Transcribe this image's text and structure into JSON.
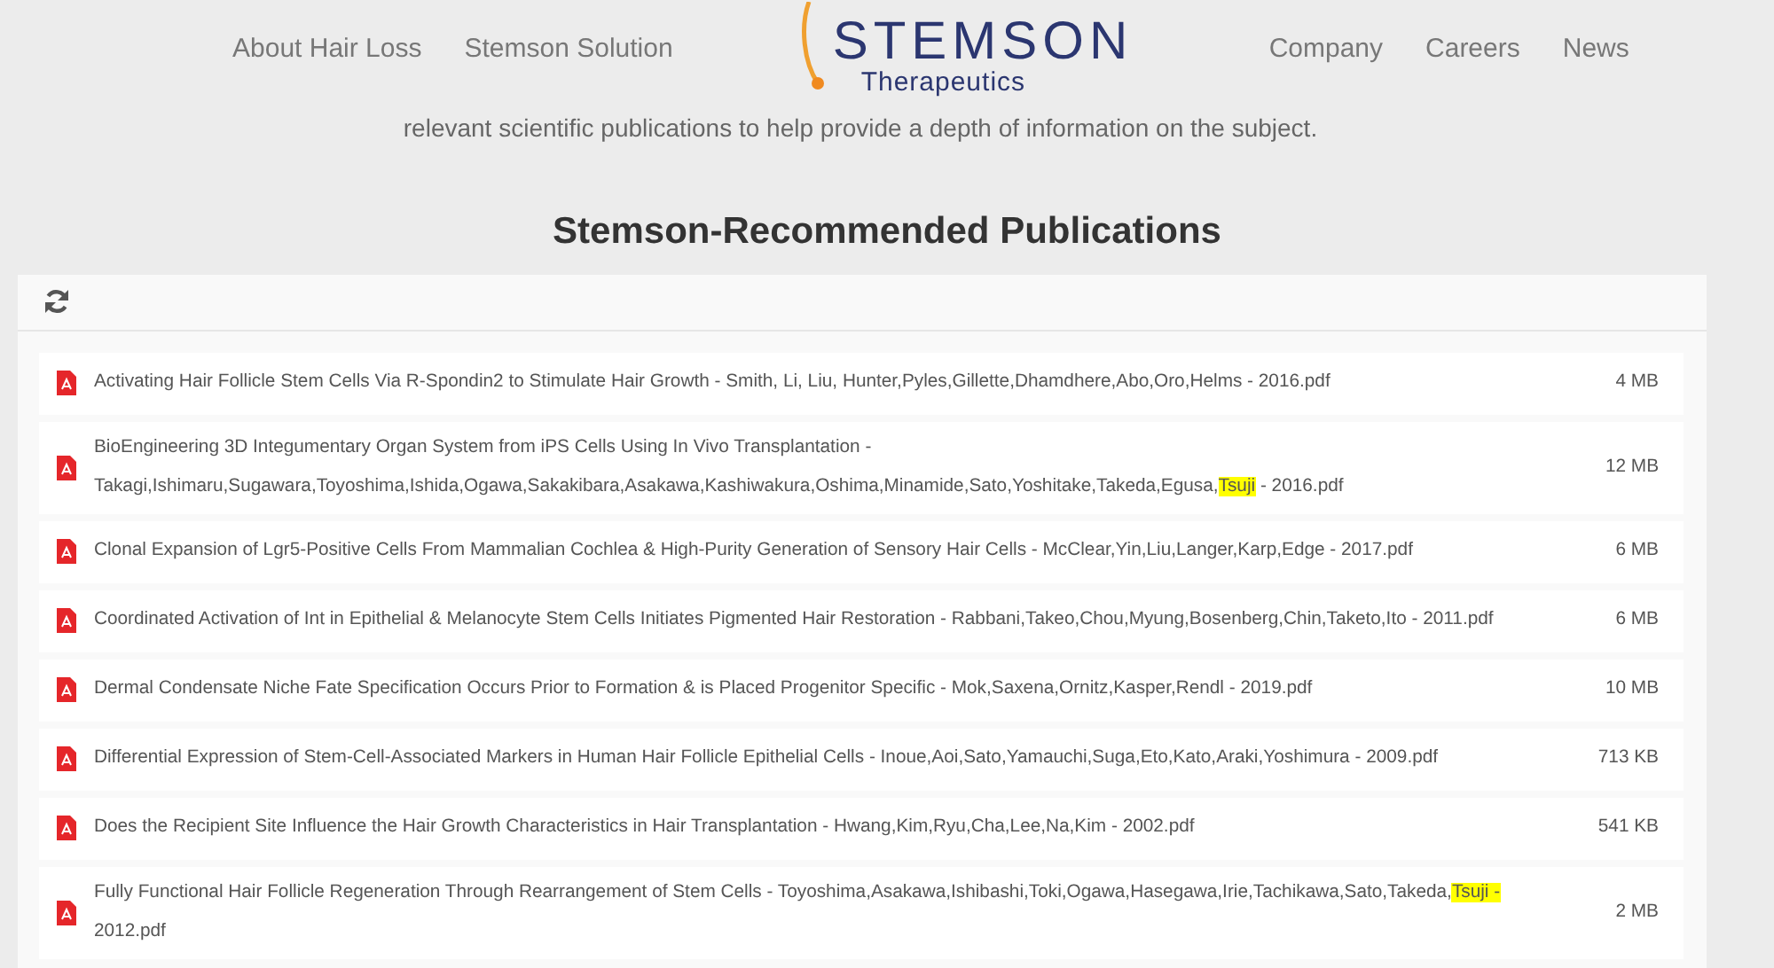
{
  "nav": {
    "left": [
      "About Hair Loss",
      "Stemson Solution"
    ],
    "logo": {
      "name": "STEMSON",
      "tagline": "Therapeutics"
    },
    "right": [
      "Company",
      "Careers",
      "News"
    ]
  },
  "intro": "relevant scientific publications to help provide a depth of information on the subject.",
  "heading": "Stemson-Recommended Publications",
  "files": [
    {
      "parts": [
        {
          "text": "Activating Hair Follicle Stem Cells Via R-Spondin2 to Stimulate Hair Growth - Smith, Li, Liu, Hunter,Pyles,Gillette,Dhamdhere,Abo,Oro,Helms - 2016.pdf",
          "highlighted": false
        }
      ],
      "size": "4 MB"
    },
    {
      "parts": [
        {
          "text": "BioEngineering 3D Integumentary Organ System from iPS Cells Using In Vivo Transplantation - Takagi,Ishimaru,Sugawara,Toyoshima,Ishida,Ogawa,Sakakibara,Asakawa,Kashiwakura,Oshima,Minamide,Sato,Yoshitake,Takeda,Egusa,",
          "highlighted": false
        },
        {
          "text": "Tsuji",
          "highlighted": true
        },
        {
          "text": " - 2016.pdf",
          "highlighted": false
        }
      ],
      "size": "12 MB"
    },
    {
      "parts": [
        {
          "text": "Clonal Expansion of Lgr5-Positive Cells From Mammalian Cochlea & High-Purity Generation of Sensory Hair Cells - McClear,Yin,Liu,Langer,Karp,Edge - 2017.pdf",
          "highlighted": false
        }
      ],
      "size": "6 MB"
    },
    {
      "parts": [
        {
          "text": "Coordinated Activation of Int in Epithelial & Melanocyte Stem Cells Initiates Pigmented Hair Restoration - Rabbani,Takeo,Chou,Myung,Bosenberg,Chin,Taketo,Ito - 2011.pdf",
          "highlighted": false
        }
      ],
      "size": "6 MB"
    },
    {
      "parts": [
        {
          "text": "Dermal Condensate Niche Fate Specification Occurs Prior to Formation & is Placed Progenitor Specific - Mok,Saxena,Ornitz,Kasper,Rendl - 2019.pdf",
          "highlighted": false
        }
      ],
      "size": "10 MB"
    },
    {
      "parts": [
        {
          "text": "Differential Expression of Stem-Cell-Associated Markers in Human Hair Follicle Epithelial Cells - Inoue,Aoi,Sato,Yamauchi,Suga,Eto,Kato,Araki,Yoshimura - 2009.pdf",
          "highlighted": false
        }
      ],
      "size": "713 KB"
    },
    {
      "parts": [
        {
          "text": "Does the Recipient Site Influence the Hair Growth Characteristics in Hair Transplantation - Hwang,Kim,Ryu,Cha,Lee,Na,Kim - 2002.pdf",
          "highlighted": false
        }
      ],
      "size": "541 KB"
    },
    {
      "parts": [
        {
          "text": "Fully Functional Hair Follicle Regeneration Through Rearrangement of Stem Cells - Toyoshima,Asakawa,Ishibashi,Toki,Ogawa,Hasegawa,Irie,Tachikawa,Sato,Takeda,",
          "highlighted": false
        },
        {
          "text": "Tsuji -",
          "highlighted": true
        },
        {
          "text": " 2012.pdf",
          "highlighted": false
        }
      ],
      "size": "2 MB"
    }
  ]
}
